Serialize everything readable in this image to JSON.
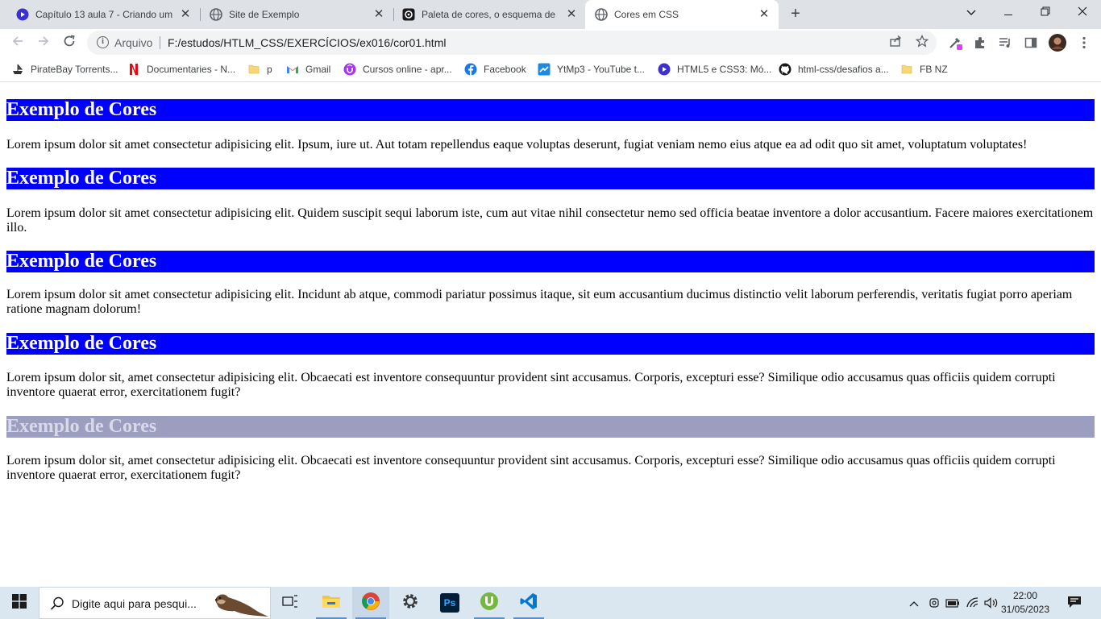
{
  "browser": {
    "tabs": [
      {
        "title": "Capítulo 13 aula 7 - Criando um s",
        "icon": "video-icon",
        "active": false
      },
      {
        "title": "Site de Exemplo",
        "icon": "globe-icon",
        "active": false
      },
      {
        "title": "Paleta de cores, o esquema de co",
        "icon": "palette-site-icon",
        "active": false
      },
      {
        "title": "Cores em CSS",
        "icon": "globe-icon",
        "active": true
      }
    ],
    "new_tab_label": "+",
    "address": {
      "scheme_label": "Arquivo",
      "url": "F:/estudos/HTLM_CSS/EXERCÍCIOS/ex016/cor01.html"
    },
    "bookmarks": [
      {
        "label": "PirateBay Torrents...",
        "icon": "ship-icon"
      },
      {
        "label": "Documentaries - N...",
        "icon": "netflix-icon"
      },
      {
        "label": "p",
        "icon": "folder-icon"
      },
      {
        "label": "Gmail",
        "icon": "gmail-icon"
      },
      {
        "label": "Cursos online - apr...",
        "icon": "udemy-icon"
      },
      {
        "label": "Facebook",
        "icon": "facebook-icon"
      },
      {
        "label": "YtMp3 - YouTube t...",
        "icon": "ytmp3-icon"
      },
      {
        "label": "HTML5 e CSS3: Mó...",
        "icon": "video-icon"
      },
      {
        "label": "html-css/desafios a...",
        "icon": "github-icon"
      },
      {
        "label": "FB NZ",
        "icon": "folder-icon"
      }
    ]
  },
  "page": {
    "sections": [
      {
        "heading": "Exemplo de Cores",
        "text": "Lorem ipsum dolor sit amet consectetur adipisicing elit. Ipsum, iure ut. Aut totam repellendus eaque voluptas deserunt, fugiat veniam nemo eius atque ea ad odit quo sit amet, voluptatum voluptates!",
        "heading_bg": "#0000ff",
        "heading_color": "#ffffff"
      },
      {
        "heading": "Exemplo de Cores",
        "text": "Lorem ipsum dolor sit amet consectetur adipisicing elit. Quidem suscipit sequi laborum iste, cum aut vitae nihil consectetur nemo sed officia beatae inventore a dolor accusantium. Facere maiores exercitationem illo.",
        "heading_bg": "#0000ff",
        "heading_color": "#ffffff"
      },
      {
        "heading": "Exemplo de Cores",
        "text": "Lorem ipsum dolor sit amet consectetur adipisicing elit. Incidunt ab atque, commodi pariatur possimus itaque, sit eum accusantium ducimus distinctio velit laborum perferendis, veritatis fugiat porro aperiam ratione magnam dolorum!",
        "heading_bg": "#0000ff",
        "heading_color": "#ffffff"
      },
      {
        "heading": "Exemplo de Cores",
        "text": "Lorem ipsum dolor sit, amet consectetur adipisicing elit. Obcaecati est inventore consequuntur provident sint accusamus. Corporis, excepturi esse? Similique odio accusamus quas officiis quidem corrupti inventore quaerat error, exercitationem fugit?",
        "heading_bg": "#0000ff",
        "heading_color": "#ffffff"
      },
      {
        "heading": "Exemplo de Cores",
        "text": "Lorem ipsum dolor sit, amet consectetur adipisicing elit. Obcaecati est inventore consequuntur provident sint accusamus. Corporis, excepturi esse? Similique odio accusamus quas officiis quidem corrupti inventore quaerat error, exercitationem fugit?",
        "heading_bg": "#9c9ec0",
        "heading_color": "#d9dae9"
      }
    ]
  },
  "taskbar": {
    "search_placeholder": "Digite aqui para pesqui...",
    "pinned": [
      "task-view-icon",
      "file-explorer-icon",
      "chrome-icon",
      "settings-icon",
      "photoshop-icon",
      "utorrent-icon",
      "vscode-icon"
    ],
    "photoshop_label": "Ps",
    "time": "22:00",
    "date": "31/05/2023"
  },
  "colors": {
    "tabstrip_bg": "#dee1e6",
    "heading_blue": "#0000ff",
    "heading_faded": "#9c9ec0",
    "taskbar_bg": "#dbe7f0"
  }
}
